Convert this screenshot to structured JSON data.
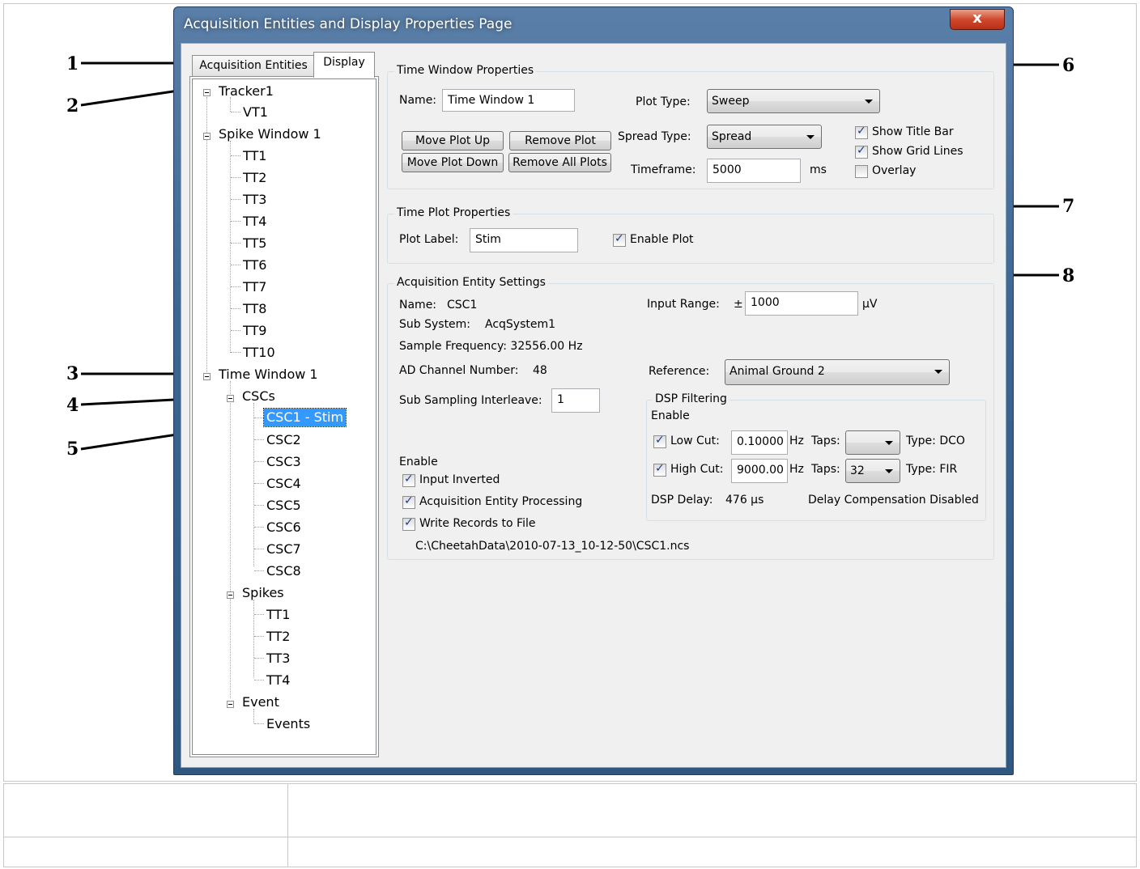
{
  "window": {
    "title": "Acquisition Entities and Display Properties Page",
    "close_label": "x"
  },
  "callouts": [
    "1",
    "2",
    "3",
    "4",
    "5",
    "6",
    "7",
    "8"
  ],
  "tabs": [
    {
      "label": "Acquisition Entities",
      "active": false
    },
    {
      "label": "Display",
      "active": true
    }
  ],
  "tree": {
    "tracker": "Tracker1",
    "tracker_children": [
      "VT1"
    ],
    "spike_window": "Spike Window 1",
    "spike_children": [
      "TT1",
      "TT2",
      "TT3",
      "TT4",
      "TT5",
      "TT6",
      "TT7",
      "TT8",
      "TT9",
      "TT10"
    ],
    "time_window": "Time Window 1",
    "cscs": "CSCs",
    "csc_children": [
      "CSC1 - Stim",
      "CSC2",
      "CSC3",
      "CSC4",
      "CSC5",
      "CSC6",
      "CSC7",
      "CSC8"
    ],
    "spikes": "Spikes",
    "spikes_children": [
      "TT1",
      "TT2",
      "TT3",
      "TT4"
    ],
    "event": "Event",
    "event_children": [
      "Events"
    ]
  },
  "time_window_properties": {
    "title": "Time Window Properties",
    "name_label": "Name:",
    "name_value": "Time Window 1",
    "plot_type_label": "Plot Type:",
    "plot_type_value": "Sweep",
    "spread_type_label": "Spread Type:",
    "spread_type_value": "Spread",
    "timeframe_label": "Timeframe:",
    "timeframe_value": "5000",
    "timeframe_unit": "ms",
    "move_up": "Move Plot Up",
    "remove_plot": "Remove Plot",
    "move_down": "Move Plot Down",
    "remove_all": "Remove All Plots",
    "show_title_bar": "Show Title Bar",
    "show_grid_lines": "Show Grid Lines",
    "overlay": "Overlay"
  },
  "time_plot_properties": {
    "title": "Time Plot Properties",
    "plot_label_label": "Plot Label:",
    "plot_label_value": "Stim",
    "enable_plot": "Enable Plot"
  },
  "acq_entity": {
    "title": "Acquisition Entity Settings",
    "name_label": "Name:",
    "name_value": "CSC1",
    "sub_system_label": "Sub System:",
    "sub_system_value": "AcqSystem1",
    "sample_freq": "Sample Frequency: 32556.00 Hz",
    "ad_channel_label": "AD Channel Number:",
    "ad_channel_value": "48",
    "sub_sampling_label": "Sub Sampling Interleave:",
    "sub_sampling_value": "1",
    "input_range_label": "Input Range:",
    "input_range_pm": "±",
    "input_range_value": "1000",
    "input_range_unit": "µV",
    "reference_label": "Reference:",
    "reference_value": "Animal Ground 2",
    "enable_label": "Enable",
    "input_inverted": "Input Inverted",
    "acq_processing": "Acquisition Entity Processing",
    "write_records": "Write Records to File",
    "file_path": "C:\\CheetahData\\2010-07-13_10-12-50\\CSC1.ncs"
  },
  "dsp": {
    "title": "DSP Filtering",
    "enable_label": "Enable",
    "low_cut_label": "Low Cut:",
    "low_cut_value": "0.10000",
    "high_cut_label": "High Cut:",
    "high_cut_value": "9000.00",
    "hz": "Hz",
    "taps_label": "Taps:",
    "low_taps_value": "",
    "high_taps_value": "32",
    "low_type": "Type:  DCO",
    "high_type": "Type:  FIR",
    "delay_label": "DSP Delay:",
    "delay_value": "476 µs",
    "delay_comp": "Delay Compensation Disabled"
  }
}
